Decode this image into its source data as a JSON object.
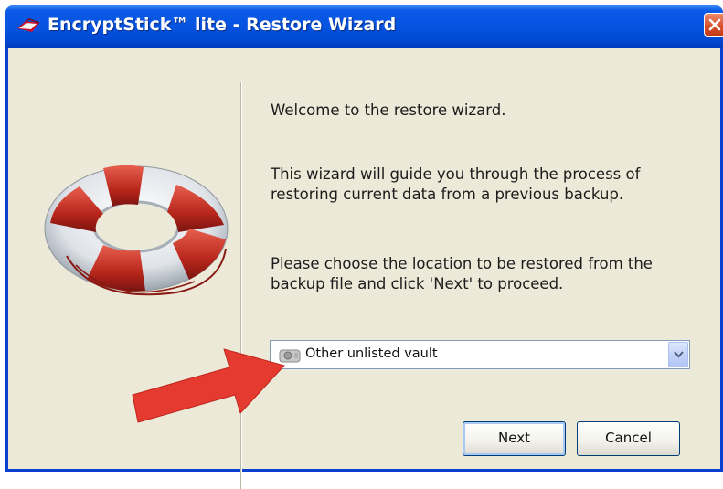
{
  "window": {
    "title": "EncryptStick™ lite - Restore Wizard",
    "icon": "encryptstick-app-icon",
    "close_icon": "close-icon"
  },
  "wizard": {
    "illustration": "lifebuoy-icon",
    "welcome": "Welcome to the restore wizard.",
    "description": "This wizard will guide you through the process of restoring current data from a previous backup.",
    "instructions": "Please choose the location to be restored from the backup file and click 'Next' to proceed.",
    "location_select": {
      "icon": "vault-icon",
      "value": "Other unlisted vault"
    },
    "annotation": "red-pointer-arrow",
    "next_label": "Next",
    "cancel_label": "Cancel"
  },
  "colors": {
    "title_bar": "#0654e0",
    "window_bg": "#ece9d8",
    "close_button": "#d9522d",
    "arrow": "#e53a2f"
  }
}
